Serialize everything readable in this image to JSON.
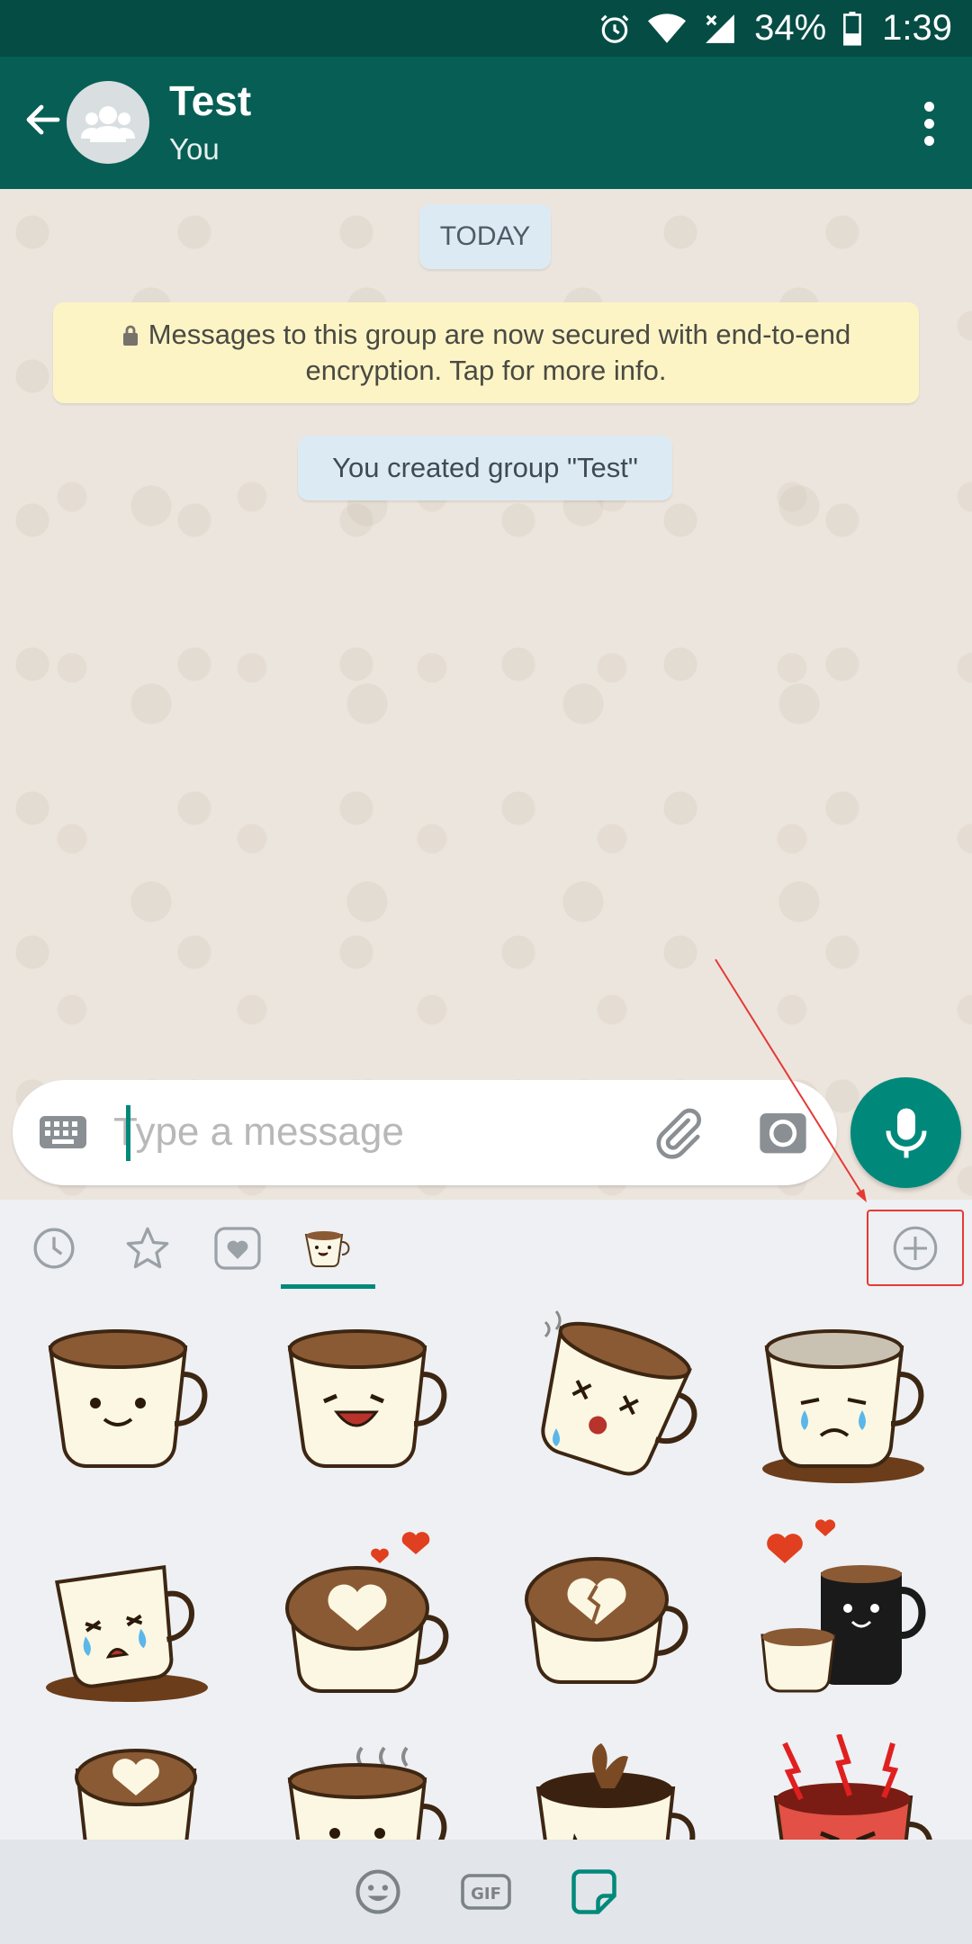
{
  "status_bar": {
    "battery": "34%",
    "time": "1:39"
  },
  "header": {
    "title": "Test",
    "subtitle": "You"
  },
  "chat": {
    "date_label": "TODAY",
    "encryption_notice": "Messages to this group are now secured with end-to-end encryption. Tap for more info.",
    "system_message": "You created group \"Test\""
  },
  "composer": {
    "placeholder": "Type a message"
  },
  "sticker_tabs": [
    "recent-icon",
    "star-icon",
    "heart-icon",
    "coffee-pack-icon"
  ],
  "active_tab": "coffee-pack-icon",
  "colors": {
    "header": "#075e54",
    "status_bar": "#054d44",
    "accent": "#00897b",
    "annotation": "#e53935"
  },
  "stickers": [
    "happy-cup",
    "laughing-cup",
    "dizzy-cup",
    "crying-spilled-cup",
    "fallen-crying-cup",
    "heart-latte",
    "broken-heart-latte",
    "mug-couple",
    "heart-latte-cup",
    "steaming-cup",
    "splashing-cup",
    "angry-red-cup"
  ]
}
